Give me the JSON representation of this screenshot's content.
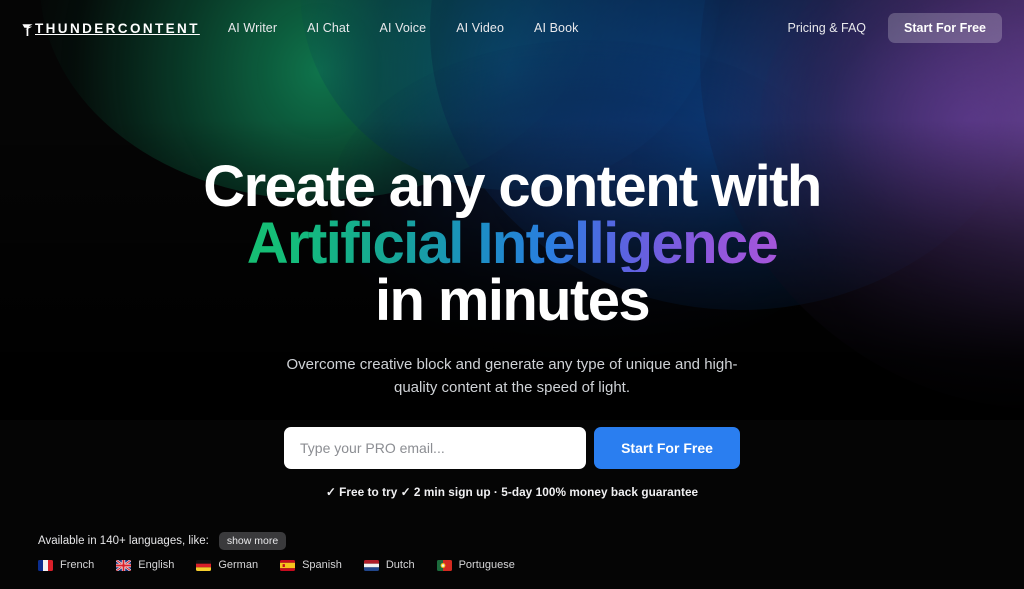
{
  "brand": {
    "name": "THUNDERCONTENT",
    "logo_icon": "lightning-bolt-icon"
  },
  "nav": {
    "links": [
      {
        "label": "AI Writer"
      },
      {
        "label": "AI Chat"
      },
      {
        "label": "AI Voice"
      },
      {
        "label": "AI Video"
      },
      {
        "label": "AI Book"
      }
    ],
    "pricing_label": "Pricing & FAQ",
    "cta_label": "Start For Free"
  },
  "hero": {
    "headline_line1": "Create any content with",
    "headline_line2": "Artificial Intelligence",
    "headline_line3": "in minutes",
    "subtitle": "Overcome creative block and generate any type of unique and high-quality content at the speed of light.",
    "email_placeholder": "Type your PRO email...",
    "email_value": "",
    "cta_label": "Start For Free",
    "guarantee": "✓ Free to try ✓ 2 min sign up · 5-day 100% money back guarantee"
  },
  "languages": {
    "heading": "Available in 140+ languages, like:",
    "show_more_label": "show more",
    "items": [
      {
        "name": "French",
        "flag_icon": "flag-france-icon"
      },
      {
        "name": "English",
        "flag_icon": "flag-uk-icon"
      },
      {
        "name": "German",
        "flag_icon": "flag-germany-icon"
      },
      {
        "name": "Spanish",
        "flag_icon": "flag-spain-icon"
      },
      {
        "name": "Dutch",
        "flag_icon": "flag-netherlands-icon"
      },
      {
        "name": "Portuguese",
        "flag_icon": "flag-portugal-icon"
      }
    ]
  },
  "colors": {
    "background": "#050505",
    "cta_blue": "#2a7ef0",
    "glow_green": "#107a50",
    "glow_blue": "#0d468c",
    "glow_purple": "#8056b0",
    "gradient_start": "#18c06a",
    "gradient_mid": "#2a7ee0",
    "gradient_end": "#b455d8"
  }
}
